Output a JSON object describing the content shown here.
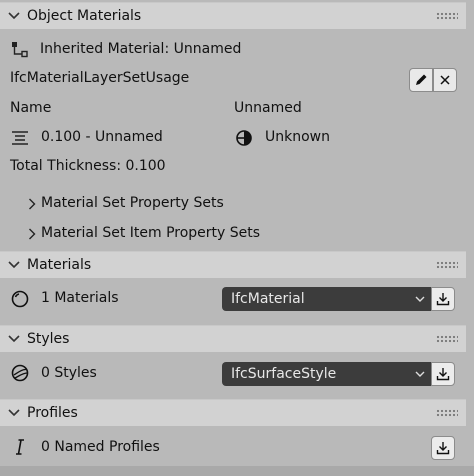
{
  "object_materials": {
    "title": "Object Materials",
    "inherited_label": "Inherited Material: Unnamed",
    "usage_label": "IfcMaterialLayerSetUsage",
    "name_label": "Name",
    "name_value": "Unnamed",
    "layer_label": "0.100 - Unnamed",
    "layer_status": "Unknown",
    "total_thickness": "Total Thickness: 0.100",
    "material_set_property_sets": "Material Set Property Sets",
    "material_set_item_property_sets": "Material Set Item Property Sets"
  },
  "materials": {
    "title": "Materials",
    "count_label": "1 Materials",
    "selected_type": "IfcMaterial"
  },
  "styles": {
    "title": "Styles",
    "count_label": "0 Styles",
    "selected_type": "IfcSurfaceStyle"
  },
  "profiles": {
    "title": "Profiles",
    "count_label": "0 Named Profiles"
  },
  "icons": {
    "expanded": "chevron-down-icon",
    "collapsed": "chevron-right-icon",
    "edit": "pencil-icon",
    "close": "x-icon",
    "import": "download-icon",
    "inherited": "hierarchy-icon",
    "layers": "align-lines-icon",
    "status": "half-circle-icon",
    "material": "sphere-icon",
    "style": "shaded-sphere-icon",
    "profile": "italic-i-icon"
  }
}
